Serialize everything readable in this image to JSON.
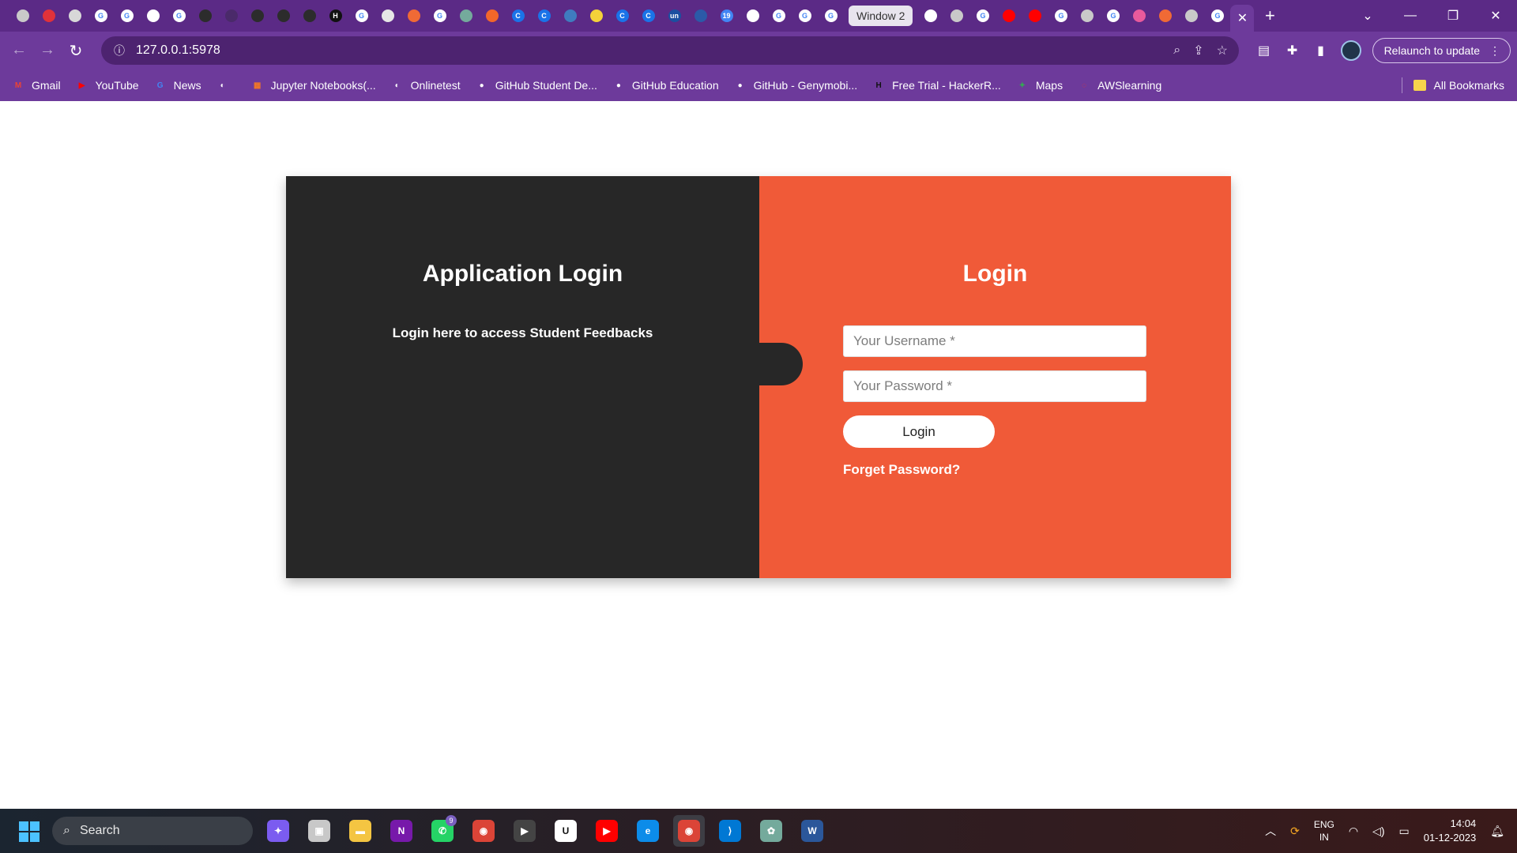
{
  "browser": {
    "tabs_visible_label": "Window 2",
    "active_tab_close": "✕",
    "new_tab": "+",
    "url": "127.0.0.1:5978",
    "relaunch_label": "Relaunch to update",
    "tab_icons": [
      {
        "name": "globe-tab-icon",
        "color": "#c9c9c9",
        "glyph": ""
      },
      {
        "name": "youtube-red-tab-icon",
        "color": "#e0323a",
        "glyph": ""
      },
      {
        "name": "github-copilot-tab-icon",
        "color": "#d8d8d8",
        "glyph": ""
      },
      {
        "name": "google-tab-icon",
        "color": "#ffffff",
        "glyph": "G"
      },
      {
        "name": "google-tab-icon",
        "color": "#ffffff",
        "glyph": "G"
      },
      {
        "name": "chrome-tab-icon",
        "color": "#ffffff",
        "glyph": ""
      },
      {
        "name": "google-tab-icon",
        "color": "#ffffff",
        "glyph": "G"
      },
      {
        "name": "openai-tab-icon",
        "color": "#2c2c2c",
        "glyph": ""
      },
      {
        "name": "blank-tab-icon",
        "color": "#4a2a6a",
        "glyph": ""
      },
      {
        "name": "openai-tab-icon",
        "color": "#2c2c2c",
        "glyph": ""
      },
      {
        "name": "openai-tab-icon",
        "color": "#2c2c2c",
        "glyph": ""
      },
      {
        "name": "openai-tab-icon",
        "color": "#2c2c2c",
        "glyph": ""
      },
      {
        "name": "hackerrank-tab-icon",
        "color": "#111111",
        "glyph": "H"
      },
      {
        "name": "google-tab-icon",
        "color": "#ffffff",
        "glyph": "G"
      },
      {
        "name": "store-tab-icon",
        "color": "#e6e6e6",
        "glyph": ""
      },
      {
        "name": "orange-tab-icon",
        "color": "#f06a35",
        "glyph": ""
      },
      {
        "name": "google-tab-icon",
        "color": "#ffffff",
        "glyph": "G"
      },
      {
        "name": "chatgpt-tab-icon",
        "color": "#74aa9c",
        "glyph": ""
      },
      {
        "name": "dots-tab-icon",
        "color": "#f2672a",
        "glyph": ""
      },
      {
        "name": "codechef-tab-icon",
        "color": "#1a73e8",
        "glyph": "C"
      },
      {
        "name": "codechef-tab-icon",
        "color": "#1a73e8",
        "glyph": "C"
      },
      {
        "name": "python-tab-icon",
        "color": "#3f7cbf",
        "glyph": ""
      },
      {
        "name": "yellow-tab-icon",
        "color": "#f4d23a",
        "glyph": ""
      },
      {
        "name": "codechef-tab-icon",
        "color": "#1a73e8",
        "glyph": "C"
      },
      {
        "name": "codechef-tab-icon",
        "color": "#1a73e8",
        "glyph": "C"
      },
      {
        "name": "unstop-tab-icon",
        "color": "#1b4fa0",
        "glyph": "un"
      },
      {
        "name": "news-tab-icon",
        "color": "#2b5aa8",
        "glyph": ""
      },
      {
        "name": "calendar-tab-icon",
        "color": "#4285f4",
        "glyph": "19"
      },
      {
        "name": "white-box-tab-icon",
        "color": "#ffffff",
        "glyph": ""
      },
      {
        "name": "google-tab-icon",
        "color": "#ffffff",
        "glyph": "G"
      },
      {
        "name": "google-tab-icon",
        "color": "#ffffff",
        "glyph": "G"
      },
      {
        "name": "google-tab-icon",
        "color": "#ffffff",
        "glyph": "G"
      }
    ],
    "tab_icons_after": [
      {
        "name": "github-tab-icon",
        "color": "#ffffff",
        "glyph": ""
      },
      {
        "name": "globe-tab-icon",
        "color": "#c9c9c9",
        "glyph": ""
      },
      {
        "name": "google-tab-icon",
        "color": "#ffffff",
        "glyph": "G"
      },
      {
        "name": "youtube-tab-icon",
        "color": "#ff0000",
        "glyph": ""
      },
      {
        "name": "youtube-tab-icon",
        "color": "#ff0000",
        "glyph": ""
      },
      {
        "name": "google-tab-icon",
        "color": "#ffffff",
        "glyph": "G"
      },
      {
        "name": "globe-tab-icon",
        "color": "#c9c9c9",
        "glyph": ""
      },
      {
        "name": "google-tab-icon",
        "color": "#ffffff",
        "glyph": "G"
      },
      {
        "name": "arc-tab-icon",
        "color": "#e85a9c",
        "glyph": ""
      },
      {
        "name": "orange-tab-icon",
        "color": "#f06a35",
        "glyph": ""
      },
      {
        "name": "globe-tab-icon",
        "color": "#c9c9c9",
        "glyph": ""
      },
      {
        "name": "google-tab-icon",
        "color": "#ffffff",
        "glyph": "G"
      }
    ]
  },
  "bookmarks": [
    {
      "label": "Gmail",
      "icon": "gmail-icon",
      "color": "#ea4335",
      "glyph": "M"
    },
    {
      "label": "YouTube",
      "icon": "youtube-icon",
      "color": "#ff0000",
      "glyph": "▶"
    },
    {
      "label": "News",
      "icon": "news-icon",
      "color": "#4285f4",
      "glyph": "G"
    },
    {
      "label": "",
      "icon": "globe-icon",
      "color": "#ffffff",
      "glyph": "◐"
    },
    {
      "label": "Jupyter Notebooks(...",
      "icon": "jupyter-icon",
      "color": "#f37726",
      "glyph": "▦"
    },
    {
      "label": "Onlinetest",
      "icon": "globe-icon",
      "color": "#ffffff",
      "glyph": "◐"
    },
    {
      "label": "GitHub Student De...",
      "icon": "github-icon",
      "color": "#ffffff",
      "glyph": "●"
    },
    {
      "label": "GitHub Education",
      "icon": "github-icon",
      "color": "#ffffff",
      "glyph": "●"
    },
    {
      "label": "GitHub - Genymobi...",
      "icon": "github-icon",
      "color": "#ffffff",
      "glyph": "●"
    },
    {
      "label": "Free Trial - HackerR...",
      "icon": "hackerrank-icon",
      "color": "#111111",
      "glyph": "H"
    },
    {
      "label": "Maps",
      "icon": "maps-icon",
      "color": "#34a853",
      "glyph": "✦"
    },
    {
      "label": "AWSlearning",
      "icon": "aws-icon",
      "color": "#e0323a",
      "glyph": "◌"
    }
  ],
  "all_bookmarks": "All Bookmarks",
  "page": {
    "left_title": "Application Login",
    "left_subtitle": "Login here to access Student Feedbacks",
    "right_title": "Login",
    "username_placeholder": "Your Username *",
    "password_placeholder": "Your Password *",
    "login_button": "Login",
    "forget_link": "Forget Password?",
    "colors": {
      "dark": "#272727",
      "accent": "#f05a38"
    }
  },
  "taskbar": {
    "search_label": "Search",
    "apps": [
      {
        "name": "copilot-icon",
        "color": "#7b5cf0",
        "glyph": "✦"
      },
      {
        "name": "task-view-icon",
        "color": "#c8c8c8",
        "glyph": "▣"
      },
      {
        "name": "file-explorer-icon",
        "color": "#f4c542",
        "glyph": "▬"
      },
      {
        "name": "onenote-icon",
        "color": "#7719aa",
        "glyph": "N"
      },
      {
        "name": "whatsapp-icon",
        "color": "#25d366",
        "glyph": "✆"
      },
      {
        "name": "chrome-icon",
        "color": "#db4437",
        "glyph": "◉"
      },
      {
        "name": "media-player-icon",
        "color": "#444444",
        "glyph": "▶"
      },
      {
        "name": "udemy-icon",
        "color": "#ffffff",
        "glyph": "U"
      },
      {
        "name": "youtube-music-icon",
        "color": "#ff0000",
        "glyph": "▶"
      },
      {
        "name": "edge-icon",
        "color": "#0c8ce9",
        "glyph": "e"
      },
      {
        "name": "chrome-active-icon",
        "color": "#db4437",
        "glyph": "◉"
      },
      {
        "name": "vscode-icon",
        "color": "#0078d4",
        "glyph": "⟩"
      },
      {
        "name": "chatgpt-icon",
        "color": "#74aa9c",
        "glyph": "✿"
      },
      {
        "name": "word-icon",
        "color": "#2b579a",
        "glyph": "W"
      }
    ],
    "whatsapp_badge": "9",
    "lang_top": "ENG",
    "lang_bottom": "IN",
    "time": "14:04",
    "date": "01-12-2023"
  }
}
